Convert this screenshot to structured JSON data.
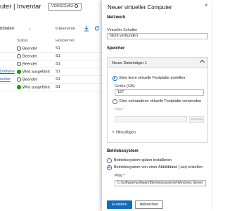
{
  "background": {
    "title": "uter | Inventar",
    "preview_badge": "VORSCHAU",
    "toolbar_label": "rbinden",
    "toolbar_caret": "⌄",
    "item_count": "6 Elemente",
    "headers": {
      "status": "Status",
      "host": "Hostserver"
    },
    "rows": [
      {
        "name": "",
        "status": "Beendet",
        "state": "stopped",
        "host": "S1"
      },
      {
        "name": "",
        "status": "Beendet",
        "state": "stopped",
        "host": "S1"
      },
      {
        "name": "",
        "status": "Beendet",
        "state": "stopped",
        "host": "S1"
      },
      {
        "name": "Domäne",
        "status": "Wird ausgeführt",
        "state": "running",
        "host": "S1"
      },
      {
        "name": "nsöler",
        "status": "Beendet",
        "state": "stopped",
        "host": "S1"
      },
      {
        "name": "",
        "status": "Wird ausgeführt",
        "state": "running",
        "host": "S1"
      }
    ]
  },
  "panel": {
    "title": "Neuer virtueller Computer",
    "close_glyph": "×",
    "network": {
      "heading": "Netzwerk",
      "switch_label": "Virtueller Schalter",
      "switch_value": "Nicht verbunden"
    },
    "storage": {
      "heading": "Speicher",
      "disk_title": "Neuer Datenträger 1",
      "option_new": "Eine leere virtuelle Festplatte erstellen",
      "size_label": "Größe (GB)",
      "size_value": "127",
      "option_existing": "Eine vorhandene virtuelle Festplatte verwenden",
      "path_label": "Pfad *",
      "browse_label": "Durchsuchen",
      "add_label": "Hinzufügen",
      "add_glyph": "+"
    },
    "os": {
      "heading": "Betriebssystem",
      "option_later": "Betriebssystem später installieren",
      "option_iso": "Betriebssystem von einer Abbilddatei (.iso) erstellen",
      "path_label": "Pfad *",
      "path_value": "C:\\software\\software\\Betriebssysteme\\Windows Server"
    },
    "buttons": {
      "create": "Erstellen",
      "cancel": "Abbrechen"
    }
  },
  "colors": {
    "accent": "#0f6cbd",
    "running": "#13a10e"
  }
}
